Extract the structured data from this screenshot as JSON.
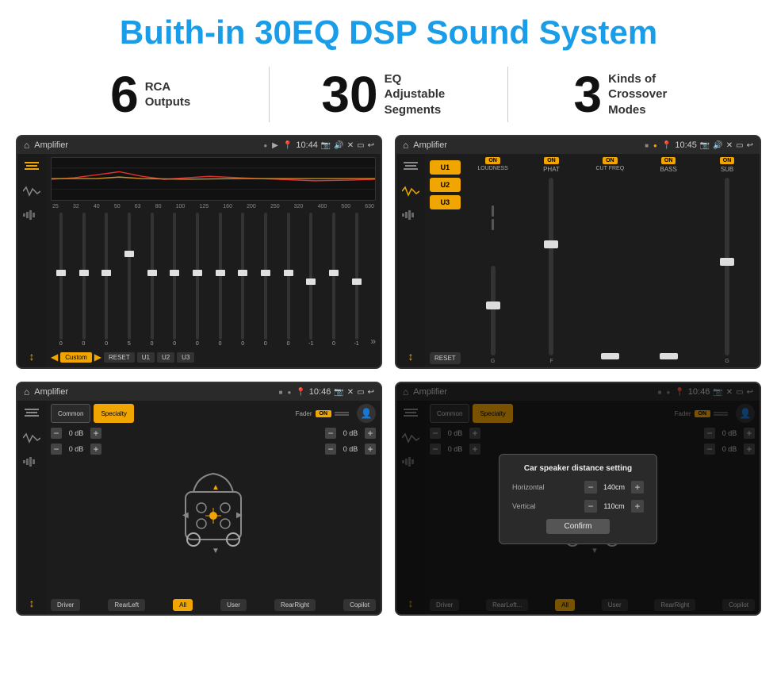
{
  "page": {
    "title": "Buith-in 30EQ DSP Sound System"
  },
  "stats": [
    {
      "number": "6",
      "text": "RCA\nOutputs"
    },
    {
      "number": "30",
      "text": "EQ Adjustable\nSegments"
    },
    {
      "number": "3",
      "text": "Kinds of\nCrossover Modes"
    }
  ],
  "screens": [
    {
      "id": "eq-screen",
      "status": {
        "title": "Amplifier",
        "time": "10:44"
      },
      "type": "eq"
    },
    {
      "id": "crossover-screen",
      "status": {
        "title": "Amplifier",
        "time": "10:45"
      },
      "type": "crossover"
    },
    {
      "id": "fader-screen",
      "status": {
        "title": "Amplifier",
        "time": "10:46"
      },
      "type": "fader"
    },
    {
      "id": "distance-screen",
      "status": {
        "title": "Amplifier",
        "time": "10:46"
      },
      "type": "fader-modal"
    }
  ],
  "eq": {
    "freqs": [
      "25",
      "32",
      "40",
      "50",
      "63",
      "80",
      "100",
      "125",
      "160",
      "200",
      "250",
      "320",
      "400",
      "500",
      "630"
    ],
    "values": [
      "0",
      "0",
      "0",
      "5",
      "0",
      "0",
      "0",
      "0",
      "0",
      "0",
      "0",
      "-1",
      "0",
      "-1"
    ],
    "preset": "Custom",
    "buttons": [
      "RESET",
      "U1",
      "U2",
      "U3"
    ]
  },
  "crossover": {
    "presets": [
      "U1",
      "U2",
      "U3"
    ],
    "channels": [
      {
        "label": "LOUDNESS",
        "on": true
      },
      {
        "label": "PHAT",
        "on": true
      },
      {
        "label": "CUT FREQ",
        "on": true
      },
      {
        "label": "BASS",
        "on": true
      },
      {
        "label": "SUB",
        "on": true
      }
    ],
    "reset": "RESET"
  },
  "fader": {
    "tabs": [
      "Common",
      "Specialty"
    ],
    "activeTab": "Specialty",
    "faderLabel": "Fader",
    "faderOn": "ON",
    "dbValues": [
      "0 dB",
      "0 dB",
      "0 dB",
      "0 dB"
    ],
    "buttons": {
      "driver": "Driver",
      "copilot": "Copilot",
      "rearLeft": "RearLeft",
      "all": "All",
      "user": "User",
      "rearRight": "RearRight"
    }
  },
  "modal": {
    "title": "Car speaker distance setting",
    "horizontal": {
      "label": "Horizontal",
      "value": "140cm"
    },
    "vertical": {
      "label": "Vertical",
      "value": "110cm"
    },
    "confirmLabel": "Confirm"
  }
}
